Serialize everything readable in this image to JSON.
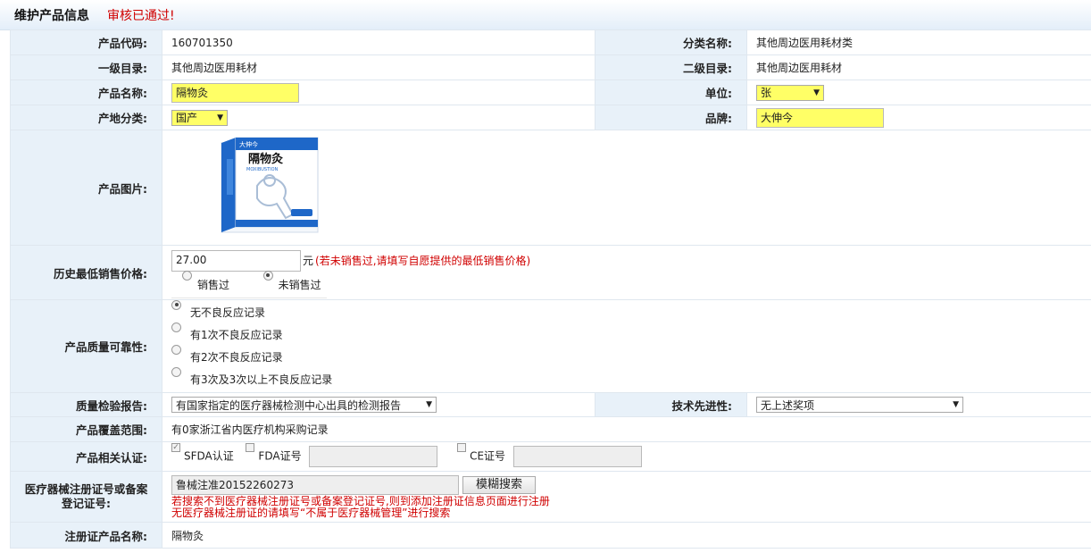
{
  "header": {
    "title": "维护产品信息",
    "status": "审核已通过!"
  },
  "rows": {
    "code": {
      "label": "产品代码:",
      "value": "160701350"
    },
    "category": {
      "label": "分类名称:",
      "value": "其他周边医用耗材类"
    },
    "level1": {
      "label": "一级目录:",
      "value": "其他周边医用耗材"
    },
    "level2": {
      "label": "二级目录:",
      "value": "其他周边医用耗材"
    },
    "name": {
      "label": "产品名称:",
      "value": "隔物灸"
    },
    "unit": {
      "label": "单位:",
      "value": "张"
    },
    "origin": {
      "label": "产地分类:",
      "value": "国产"
    },
    "brand": {
      "label": "品牌:",
      "value": "大伸今"
    },
    "image": {
      "label": "产品图片:",
      "box_brand": "大伸今",
      "box_title": "隔物灸",
      "box_sub": "MOXIBUSTION"
    },
    "price": {
      "label": "历史最低销售价格:",
      "value": "27.00",
      "unit": "元",
      "hint": "(若未销售过,请填写自愿提供的最低销售价格)",
      "options": [
        "销售过",
        "未销售过"
      ],
      "selected": 1
    },
    "quality": {
      "label": "产品质量可靠性:",
      "options": [
        "无不良反应记录",
        "有1次不良反应记录",
        "有2次不良反应记录",
        "有3次及3次以上不良反应记录"
      ],
      "selected": 0
    },
    "inspection": {
      "label": "质量检验报告:",
      "value": "有国家指定的医疗器械检测中心出具的检测报告"
    },
    "tech": {
      "label": "技术先进性:",
      "value": "无上述奖项"
    },
    "coverage": {
      "label": "产品覆盖范围:",
      "value": "有0家浙江省内医疗机构采购记录"
    },
    "cert": {
      "label": "产品相关认证:",
      "sfda": "SFDA认证",
      "fda": "FDA证号",
      "ce": "CE证号"
    },
    "reg": {
      "label_line1": "医疗器械注册证号或备案",
      "label_line2": "登记证号:",
      "value": "鲁械注准20152260273",
      "button": "模糊搜索",
      "hint1": "若搜索不到医疗器械注册证号或备案登记证号,则到添加注册证信息页面进行注册",
      "hint2": "无医疗器械注册证的请填写“不属于医疗器械管理”进行搜索"
    },
    "regname": {
      "label": "注册证产品名称:",
      "value": "隔物灸"
    }
  },
  "colors": {
    "label_bg": "#e8f1f9",
    "highlight": "#ffff66",
    "alert": "#d00000",
    "box_blue": "#1e67c8"
  }
}
